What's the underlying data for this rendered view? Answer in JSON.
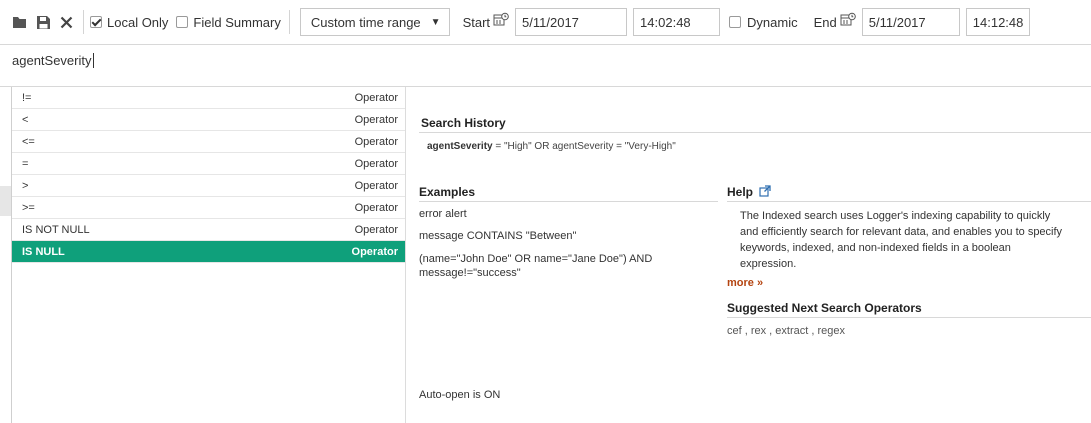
{
  "toolbar": {
    "local_only_label": "Local Only",
    "local_only_checked": true,
    "field_summary_label": "Field Summary",
    "field_summary_checked": false,
    "time_range_value": "Custom time range",
    "start_label": "Start",
    "start_date": "5/11/2017",
    "start_time": "14:02:48",
    "dynamic_label": "Dynamic",
    "dynamic_checked": false,
    "end_label": "End",
    "end_date": "5/11/2017",
    "end_time": "14:12:48"
  },
  "search": {
    "query": "agentSeverity"
  },
  "suggestions": [
    {
      "name": "!=",
      "type": "Operator"
    },
    {
      "name": "<",
      "type": "Operator"
    },
    {
      "name": "<=",
      "type": "Operator"
    },
    {
      "name": "=",
      "type": "Operator"
    },
    {
      "name": ">",
      "type": "Operator"
    },
    {
      "name": ">=",
      "type": "Operator"
    },
    {
      "name": "IS NOT NULL",
      "type": "Operator"
    },
    {
      "name": "IS NULL",
      "type": "Operator",
      "selected": true
    }
  ],
  "panel": {
    "history_title": "Search History",
    "history_field": "agentSeverity",
    "history_rest": " = \"High\" OR agentSeverity = \"Very-High\"",
    "examples_title": "Examples",
    "examples": [
      "error alert",
      "message CONTAINS \"Between\"",
      "(name=\"John Doe\" OR name=\"Jane Doe\") AND",
      "message!=\"success\""
    ],
    "help_title": "Help",
    "help_text": "The Indexed search uses Logger's indexing capability to quickly and efficiently search for relevant data, and enables you to specify keywords, indexed, and non-indexed fields in a boolean expression.",
    "more_link": "more »",
    "next_ops_title": "Suggested Next Search Operators",
    "next_ops": "cef , rex , extract , regex",
    "auto_open": "Auto-open is ON"
  },
  "colors": {
    "selected_row": "#0fa07b",
    "more_link": "#b44410"
  },
  "icons": [
    "folder-icon",
    "save-icon",
    "close-icon",
    "calendar-clock-icon",
    "external-link-icon"
  ]
}
